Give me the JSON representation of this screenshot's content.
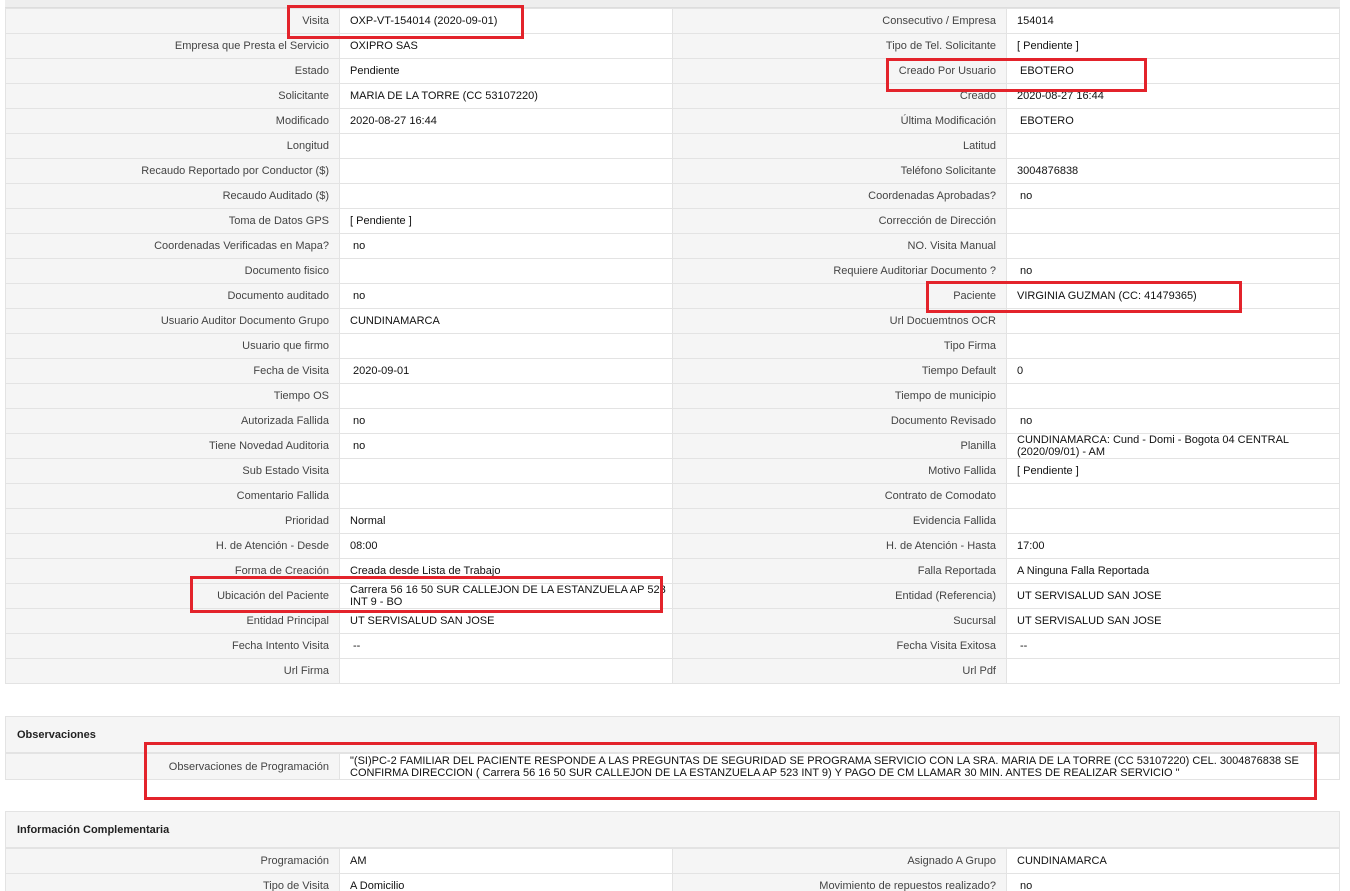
{
  "main_rows": [
    {
      "l1": "Visita",
      "v1": "OXP-VT-154014 (2020-09-01)",
      "l2": "Consecutivo / Empresa",
      "v2": "154014"
    },
    {
      "l1": "Empresa que Presta el Servicio",
      "v1": "OXIPRO SAS",
      "l2": "Tipo de Tel. Solicitante",
      "v2": "[ Pendiente ]"
    },
    {
      "l1": "Estado",
      "v1": "Pendiente",
      "l2": "Creado Por Usuario",
      "v2": "EBOTERO"
    },
    {
      "l1": "Solicitante",
      "v1": "MARIA DE LA TORRE (CC 53107220)",
      "l2": "Creado",
      "v2": "2020-08-27 16:44"
    },
    {
      "l1": "Modificado",
      "v1": "2020-08-27 16:44",
      "l2": "Última Modificación",
      "v2": "EBOTERO"
    },
    {
      "l1": "Longitud",
      "v1": "",
      "l2": "Latitud",
      "v2": ""
    },
    {
      "l1": "Recaudo Reportado por Conductor ($)",
      "v1": "",
      "l2": "Teléfono Solicitante",
      "v2": "3004876838"
    },
    {
      "l1": "Recaudo Auditado ($)",
      "v1": "",
      "l2": "Coordenadas Aprobadas?",
      "v2": "no"
    },
    {
      "l1": "Toma de Datos GPS",
      "v1": "[ Pendiente ]",
      "l2": "Corrección de Dirección",
      "v2": ""
    },
    {
      "l1": "Coordenadas Verificadas en Mapa?",
      "v1": "no",
      "l2": "NO. Visita Manual",
      "v2": ""
    },
    {
      "l1": "Documento fisico",
      "v1": "",
      "l2": "Requiere Auditoriar Documento ?",
      "v2": "no"
    },
    {
      "l1": "Documento auditado",
      "v1": "no",
      "l2": "Paciente",
      "v2": "VIRGINIA GUZMAN (CC: 41479365)"
    },
    {
      "l1": "Usuario Auditor Documento Grupo",
      "v1": "CUNDINAMARCA",
      "l2": "Url Docuemtnos OCR",
      "v2": ""
    },
    {
      "l1": "Usuario que firmo",
      "v1": "",
      "l2": "Tipo Firma",
      "v2": ""
    },
    {
      "l1": "Fecha de Visita",
      "v1": "2020-09-01",
      "l2": "Tiempo Default",
      "v2": "0"
    },
    {
      "l1": "Tiempo OS",
      "v1": "",
      "l2": "Tiempo de municipio",
      "v2": ""
    },
    {
      "l1": "Autorizada Fallida",
      "v1": "no",
      "l2": "Documento Revisado",
      "v2": "no"
    },
    {
      "l1": "Tiene Novedad Auditoria",
      "v1": "no",
      "l2": "Planilla",
      "v2": "CUNDINAMARCA: Cund - Domi - Bogota 04 CENTRAL (2020/09/01) - AM"
    },
    {
      "l1": "Sub Estado Visita",
      "v1": "",
      "l2": "Motivo Fallida",
      "v2": "[ Pendiente ]"
    },
    {
      "l1": "Comentario Fallida",
      "v1": "",
      "l2": "Contrato de Comodato",
      "v2": ""
    },
    {
      "l1": "Prioridad",
      "v1": "Normal",
      "l2": "Evidencia Fallida",
      "v2": ""
    },
    {
      "l1": "H. de Atención - Desde",
      "v1": "08:00",
      "l2": "H. de Atención - Hasta",
      "v2": "17:00"
    },
    {
      "l1": "Forma de Creación",
      "v1": "Creada desde Lista de Trabajo",
      "l2": "Falla Reportada",
      "v2": "A Ninguna Falla Reportada"
    },
    {
      "l1": "Ubicación del Paciente",
      "v1": "Carrera 56 16 50 SUR CALLEJON DE LA ESTANZUELA AP 523 INT 9 - BO",
      "l2": "Entidad (Referencia)",
      "v2": "UT SERVISALUD SAN JOSE"
    },
    {
      "l1": "Entidad Principal",
      "v1": "UT SERVISALUD SAN JOSE",
      "l2": "Sucursal",
      "v2": "UT SERVISALUD SAN JOSE"
    },
    {
      "l1": "Fecha Intento Visita",
      "v1": "--",
      "l2": "Fecha Visita Exitosa",
      "v2": "--"
    },
    {
      "l1": "Url Firma",
      "v1": "",
      "l2": "Url Pdf",
      "v2": ""
    }
  ],
  "observaciones": {
    "title": "Observaciones",
    "label": "Observaciones de Programación",
    "value": "\"(SI)PC-2 FAMILIAR DEL PACIENTE RESPONDE A LAS PREGUNTAS DE SEGURIDAD SE PROGRAMA SERVICIO CON LA SRA. MARIA DE LA TORRE (CC 53107220) CEL. 3004876838 SE CONFIRMA DIRECCION ( Carrera 56 16 50 SUR CALLEJON DE LA ESTANZUELA AP 523 INT 9) Y PAGO DE CM LLAMAR 30 MIN. ANTES DE REALIZAR SERVICIO \""
  },
  "complementaria": {
    "title": "Información Complementaria",
    "rows": [
      {
        "l1": "Programación",
        "v1": "AM",
        "l2": "Asignado A Grupo",
        "v2": "CUNDINAMARCA"
      },
      {
        "l1": "Tipo de Visita",
        "v1": "A Domicilio",
        "l2": "Movimiento de repuestos realizado?",
        "v2": "no"
      }
    ]
  },
  "highlight_color": "#e3232b"
}
